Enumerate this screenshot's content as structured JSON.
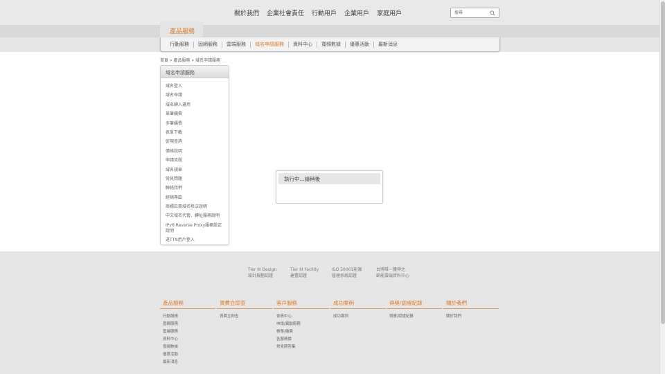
{
  "top_nav": [
    "關於我們",
    "企業社會責任",
    "行動用戶",
    "企業用戶",
    "家庭用戶"
  ],
  "search": {
    "placeholder": "搜尋",
    "icon": "search-icon"
  },
  "product_tab": "產品服務",
  "sub_nav": [
    {
      "label": "行動服務",
      "active": false
    },
    {
      "label": "固網服務",
      "active": false
    },
    {
      "label": "雲端服務",
      "active": false
    },
    {
      "label": "域名申請服務",
      "active": true
    },
    {
      "label": "資料中心",
      "active": false
    },
    {
      "label": "寬頻數據",
      "active": false
    },
    {
      "label": "優惠活動",
      "active": false
    },
    {
      "label": "最新消息",
      "active": false
    }
  ],
  "breadcrumb": "首頁 » 產品服務 » 域名申請服務",
  "side_menu": {
    "title": "域名申請服務",
    "items": [
      "域名登入",
      "域名申請",
      "域名轉入遷用",
      "單筆續費",
      "多筆續費",
      "表單下載",
      "促現查詢",
      "價格說明",
      "申請流程",
      "域名規章",
      "常見問題",
      "聯絡我們",
      "經銷專區",
      "商標註冊域名移法說明",
      "中文域名代管、轉址服務說明",
      "IPv6 Reverse Proxy服務設定說明",
      "遠TTN用戶登入"
    ]
  },
  "dialog": {
    "message": "執行中...請稍後"
  },
  "certifications": [
    {
      "line1": "Tier III Design",
      "line2": "設計規劃認證"
    },
    {
      "line1": "Tier III Facility",
      "line2": "建置認證"
    },
    {
      "line1": "ISO 50001能源",
      "line2": "管理系統認證"
    },
    {
      "line1": "台灣唯一獲得之",
      "line2": "節能雲端資料中心"
    }
  ],
  "footer_columns": [
    {
      "title": "產品服務",
      "links": [
        "行動服務",
        "固網服務",
        "雲端服務",
        "資料中心",
        "寬頻數據",
        "優惠活動",
        "最新消息"
      ]
    },
    {
      "title": "資費立即查",
      "links": [
        "資費立即查"
      ]
    },
    {
      "title": "客戶服務",
      "links": [
        "會員中心",
        "申請/異動服務",
        "帳單/繳費",
        "各服務據",
        "常見問答集"
      ]
    },
    {
      "title": "成功案例",
      "links": [
        "成功案例"
      ]
    },
    {
      "title": "得獎/認證紀錄",
      "links": [
        "得獎/認證紀錄"
      ]
    },
    {
      "title": "關於我們",
      "links": [
        "關於我們"
      ]
    }
  ],
  "colors": {
    "accent": "#e07b26",
    "page_bg": "#e6e6e6",
    "content_bg": "#ffffff"
  }
}
